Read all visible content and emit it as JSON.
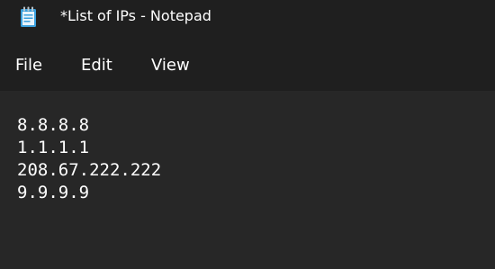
{
  "window": {
    "title": "*List of IPs - Notepad",
    "icon": "notepad-icon"
  },
  "menu": {
    "file": "File",
    "edit": "Edit",
    "view": "View"
  },
  "document": {
    "lines": [
      "8.8.8.8",
      "1.1.1.1",
      "208.67.222.222",
      "9.9.9.9"
    ]
  },
  "colors": {
    "chrome_background": "#1f1f1f",
    "editor_background": "#272727",
    "text": "#ffffff",
    "icon_accent": "#3aa0de"
  }
}
